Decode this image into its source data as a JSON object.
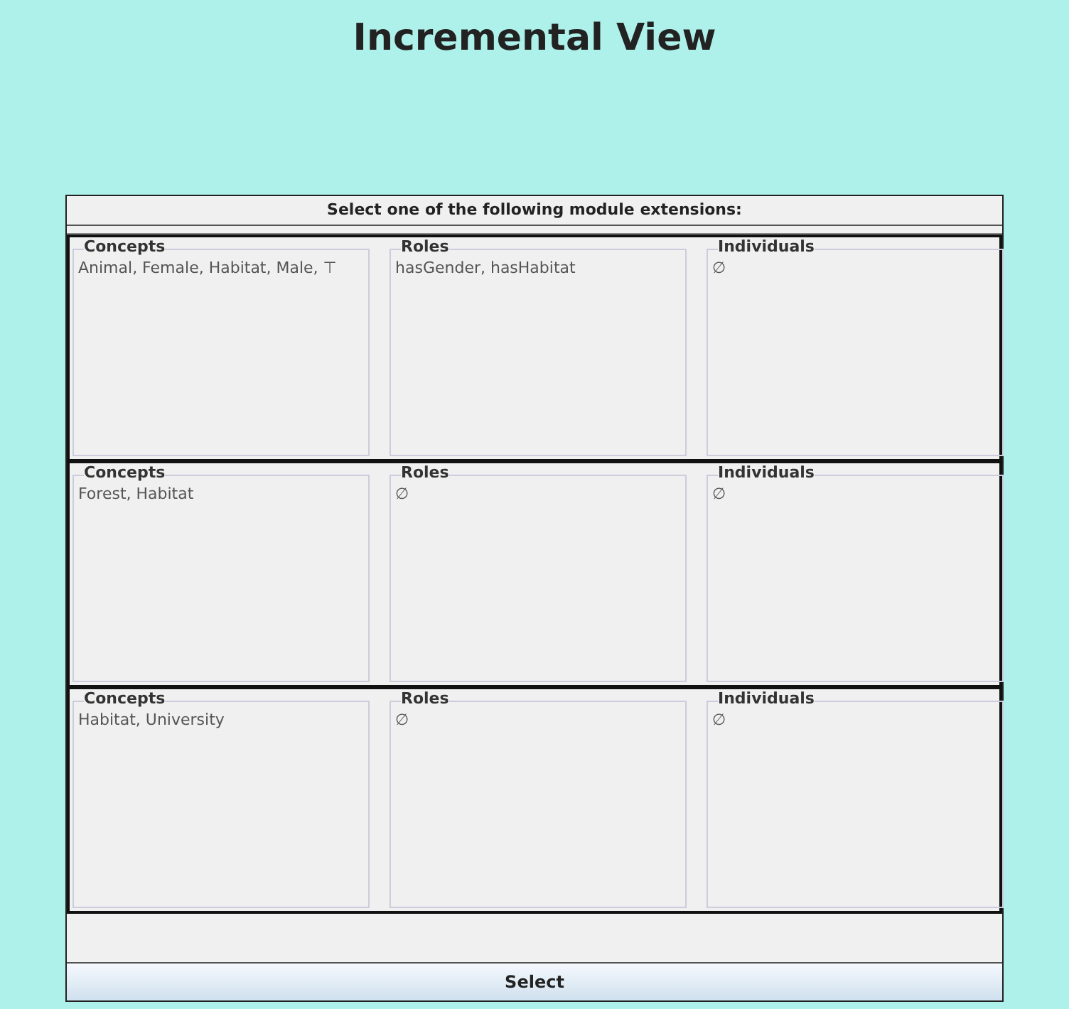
{
  "title": "Incremental View",
  "panel": {
    "heading": "Select one of the following module extensions:",
    "extensions": [
      {
        "groups": [
          {
            "label": "Concepts",
            "value": "Animal, Female, Habitat, Male, ⊤"
          },
          {
            "label": "Roles",
            "value": "hasGender, hasHabitat"
          },
          {
            "label": "Individuals",
            "value": "∅"
          }
        ]
      },
      {
        "groups": [
          {
            "label": "Concepts",
            "value": "Forest, Habitat"
          },
          {
            "label": "Roles",
            "value": "∅"
          },
          {
            "label": "Individuals",
            "value": "∅"
          }
        ]
      },
      {
        "groups": [
          {
            "label": "Concepts",
            "value": "Habitat, University"
          },
          {
            "label": "Roles",
            "value": "∅"
          },
          {
            "label": "Individuals",
            "value": "∅"
          }
        ]
      }
    ]
  },
  "button": "Select"
}
